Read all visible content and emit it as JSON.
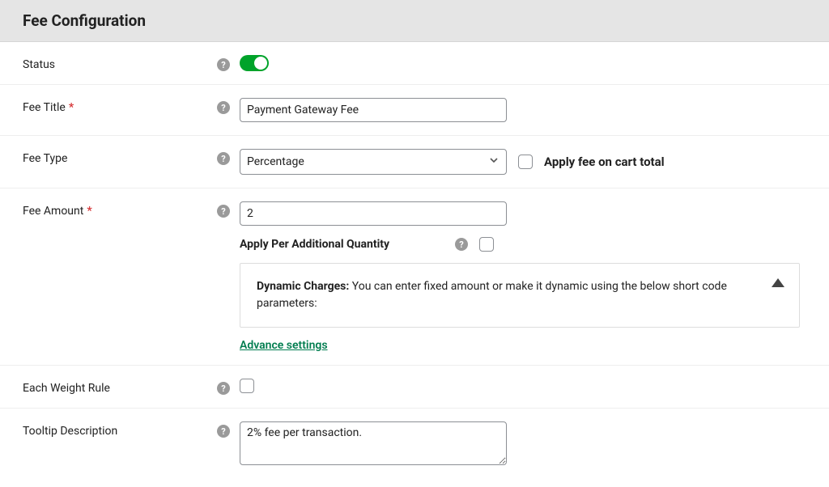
{
  "header": {
    "title": "Fee Configuration"
  },
  "status": {
    "label": "Status",
    "enabled": true
  },
  "feeTitle": {
    "label": "Fee Title",
    "required": "*",
    "value": "Payment Gateway Fee"
  },
  "feeType": {
    "label": "Fee Type",
    "selected": "Percentage",
    "applyOnCartTotalLabel": "Apply fee on cart total"
  },
  "feeAmount": {
    "label": "Fee Amount",
    "required": "*",
    "value": "2",
    "applyPerQtyLabel": "Apply Per Additional Quantity",
    "dynamicChargesBold": "Dynamic Charges:",
    "dynamicChargesText": " You can enter fixed amount or make it dynamic using the below short code parameters:",
    "advanceSettings": "Advance settings"
  },
  "eachWeightRule": {
    "label": "Each Weight Rule"
  },
  "tooltip": {
    "label": "Tooltip Description",
    "value": "2% fee per transaction."
  }
}
